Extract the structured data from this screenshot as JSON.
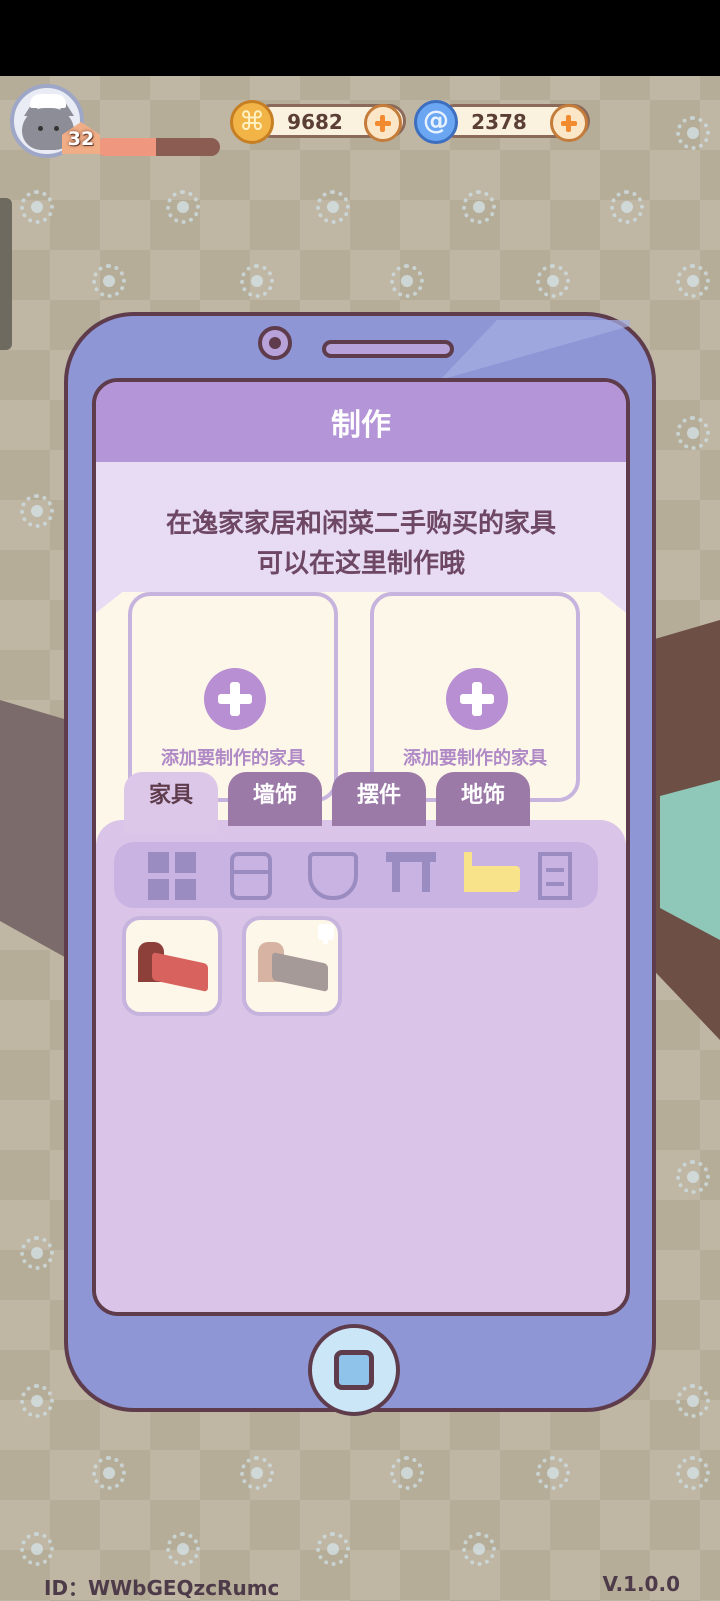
{
  "hud": {
    "level": "32",
    "xp_fraction": 0.48,
    "coins": "9682",
    "gems": "2378",
    "coin_icon": "coin-icon",
    "gem_icon": "swirl-gem-icon"
  },
  "craft": {
    "title": "制作",
    "description_line1": "在逸家家居和闲菜二手购买的家具",
    "description_line2": "可以在这里制作哦",
    "slots": [
      {
        "label": "添加要制作的家具"
      },
      {
        "label": "添加要制作的家具"
      }
    ],
    "tabs": [
      {
        "label": "家具",
        "active": true
      },
      {
        "label": "墙饰",
        "active": false
      },
      {
        "label": "摆件",
        "active": false
      },
      {
        "label": "地饰",
        "active": false
      }
    ],
    "categories": [
      {
        "icon": "grid-icon"
      },
      {
        "icon": "fridge-icon"
      },
      {
        "icon": "toilet-icon"
      },
      {
        "icon": "table-icon"
      },
      {
        "icon": "bed-icon",
        "selected": true
      },
      {
        "icon": "shelf-icon"
      }
    ],
    "items": [
      {
        "icon": "red-bed-icon"
      },
      {
        "icon": "beige-bed-icon",
        "badge": "brush-icon"
      }
    ]
  },
  "footer": {
    "id": "ID：WWbGEQzcRumc",
    "version": "V.1.0.0"
  },
  "colors": {
    "accent_purple": "#b495d7",
    "frame_dark": "#5e3c4c",
    "phone_body": "#8e96d6"
  }
}
